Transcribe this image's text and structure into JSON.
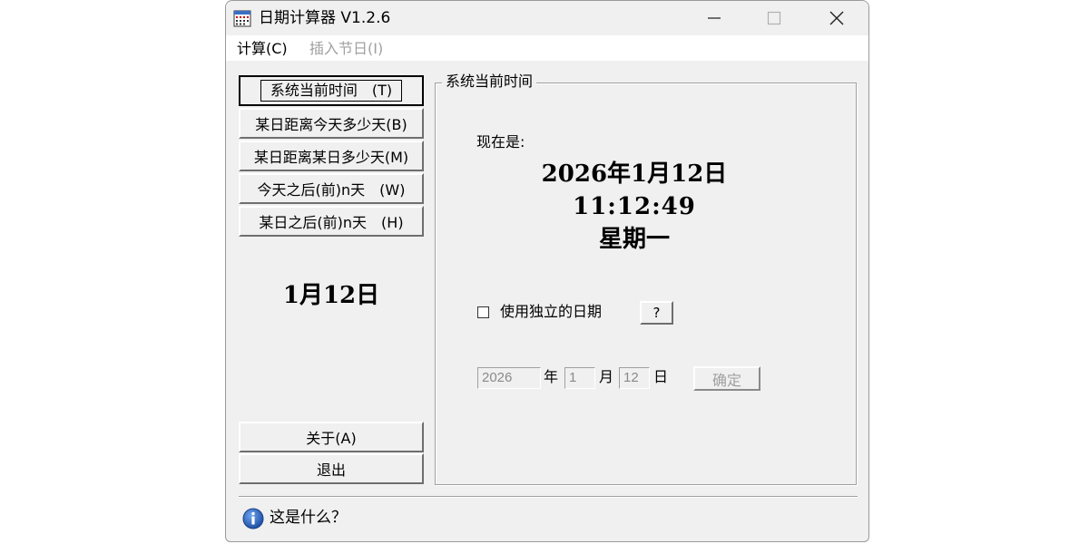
{
  "window": {
    "title": "日期计算器  V1.2.6",
    "controls": {
      "minimize": "—",
      "maximize": "□",
      "close": "✕"
    }
  },
  "menu": {
    "calc": "计算(C)",
    "insert_holiday": "插入节日(I)"
  },
  "left_buttons": [
    {
      "label": "系统当前时间　(T)"
    },
    {
      "label": "某日距离今天多少天(B)"
    },
    {
      "label": "某日距离某日多少天(M)"
    },
    {
      "label": "今天之后(前)n天　(W)"
    },
    {
      "label": "某日之后(前)n天　(H)"
    }
  ],
  "left_date": "1月12日",
  "bottom_buttons": {
    "about": "关于(A)",
    "exit": "退出"
  },
  "group": {
    "title": "系统当前时间",
    "now_label": "现在是:",
    "date": "2026年1月12日",
    "time": "11:12:49",
    "weekday": "星期一",
    "checkbox_label": "使用独立的日期",
    "checkbox_checked": false,
    "help_button": "?",
    "year_value": "2026",
    "year_unit": "年",
    "month_value": "1",
    "month_unit": "月",
    "day_value": "12",
    "day_unit": "日",
    "confirm_button": "确定"
  },
  "footer": {
    "whatis": "这是什么？"
  },
  "colors": {
    "window_bg": "#f0f0f0",
    "info_icon": "#1e5fb4",
    "disabled_text": "#a0a0a0"
  }
}
